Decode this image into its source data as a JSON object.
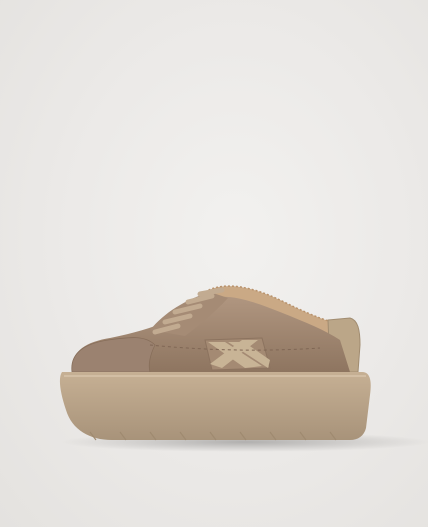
{
  "image": {
    "subject": "sneaker",
    "colors": {
      "background": "#ebe9e7",
      "suede": "#a48a73",
      "suede_shadow": "#8c735f",
      "sole": "#bda689",
      "sole_shadow": "#9f8a70",
      "shearling": "#c9aa87",
      "logo_panel": "#c8b496",
      "heel_tab": "#bba688"
    }
  }
}
